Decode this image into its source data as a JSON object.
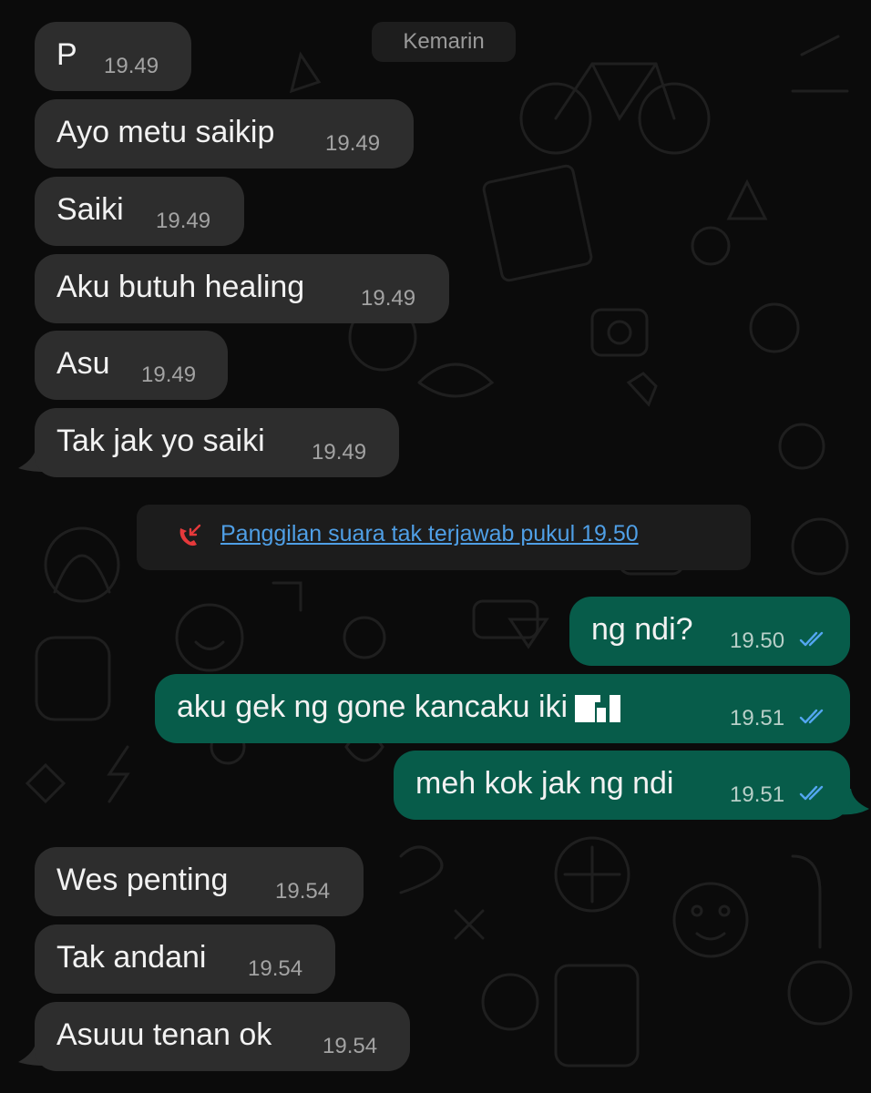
{
  "date_separator": "Kemarin",
  "messages_in_1": [
    {
      "text": "P",
      "time": "19.49"
    },
    {
      "text": "Ayo metu saikip",
      "time": "19.49"
    },
    {
      "text": "Saiki",
      "time": "19.49"
    },
    {
      "text": "Aku butuh healing",
      "time": "19.49"
    },
    {
      "text": "Asu",
      "time": "19.49"
    },
    {
      "text": "Tak jak yo saiki",
      "time": "19.49"
    }
  ],
  "missed_call": {
    "icon": "missed-call-icon",
    "text": "Panggilan suara tak terjawab pukul 19.50",
    "color": "#4f9fe6"
  },
  "messages_out": [
    {
      "text": "ng ndi?",
      "time": "19.50",
      "status": "read"
    },
    {
      "text": "aku gek ng gone kancaku iki",
      "time": "19.51",
      "status": "read"
    },
    {
      "text": "meh kok jak ng ndi",
      "time": "19.51",
      "status": "read"
    }
  ],
  "messages_in_2": [
    {
      "text": "Wes penting",
      "time": "19.54"
    },
    {
      "text": "Tak andani",
      "time": "19.54"
    },
    {
      "text": "Asuuu tenan ok",
      "time": "19.54"
    }
  ],
  "colors": {
    "incoming_bubble": "#2d2d2d",
    "outgoing_bubble": "#075c4a",
    "read_ticks": "#53a6f0",
    "background": "#0b0b0b"
  }
}
